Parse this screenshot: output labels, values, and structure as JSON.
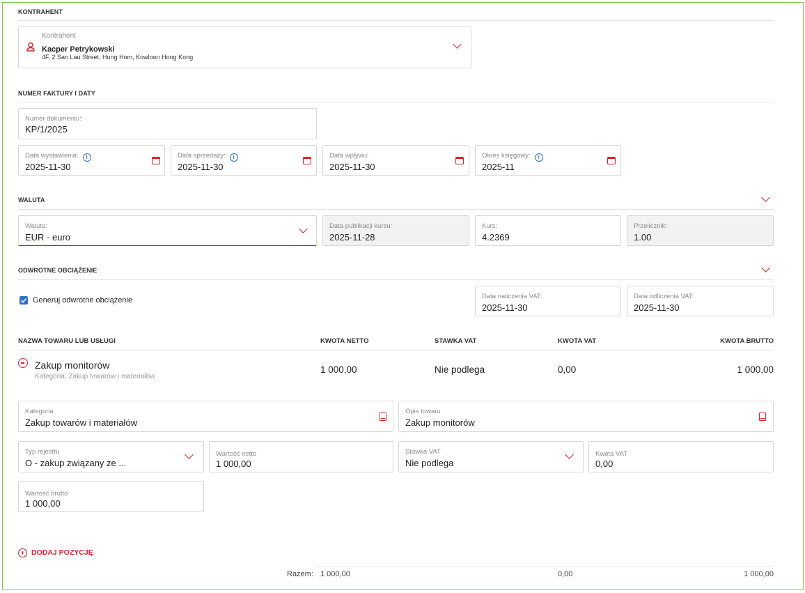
{
  "sections": {
    "kontrahent": "KONTRAHENT",
    "numer": "NUMER FAKTURY I DATY",
    "waluta": "WALUTA",
    "odwrotne": "ODWROTNE OBCIĄŻENIE"
  },
  "contractor": {
    "label": "Kontrahent",
    "name": "Kacper Petrykowski",
    "address": "4F, 2 San Lau Street, Hung Hom, Kowloon Hong Kong"
  },
  "document": {
    "number_label": "Numer dokumentu:",
    "number_value": "KP/1/2025",
    "issue_label": "Data wystawienia:",
    "issue_value": "2025-11-30",
    "sale_label": "Data sprzedaży:",
    "sale_value": "2025-11-30",
    "receipt_label": "Data wpływu:",
    "receipt_value": "2025-11-30",
    "period_label": "Okres księgowy:",
    "period_value": "2025-11"
  },
  "currency": {
    "currency_label": "Waluta:",
    "currency_value": "EUR - euro",
    "pub_label": "Data publikacji kursu:",
    "pub_value": "2025-11-28",
    "rate_label": "Kurs:",
    "rate_value": "4.2369",
    "conv_label": "Przelicznik:",
    "conv_value": "1.00"
  },
  "reverse": {
    "checkbox_label": "Generuj odwrotne obciążenie",
    "checked": true,
    "vat_charge_label": "Data naliczenia VAT:",
    "vat_charge_value": "2025-11-30",
    "vat_deduct_label": "Data odliczenia VAT:",
    "vat_deduct_value": "2025-11-30"
  },
  "table": {
    "headers": {
      "name": "NAZWA TOWARU LUB USŁUGI",
      "netto": "KWOTA NETTO",
      "rate": "STAWKA VAT",
      "vat": "KWOTA VAT",
      "brutto": "KWOTA BRUTTO"
    },
    "row": {
      "name": "Zakup monitorów",
      "category": "Kategoria: Zakup towarów i materiałów",
      "netto": "1 000,00",
      "rate": "Nie podlega",
      "vat": "0,00",
      "brutto": "1 000,00"
    }
  },
  "item_form": {
    "category_label": "Kategoria",
    "category_value": "Zakup towarów i materiałów",
    "desc_label": "Opis towaru",
    "desc_value": "Zakup monitorów",
    "register_label": "Typ rejestru",
    "register_value": "O - zakup związany ze ...",
    "netto_label": "Wartość netto",
    "netto_value": "1 000,00",
    "rate_label": "Stawka VAT",
    "rate_value": "Nie podlega",
    "vat_label": "Kwota VAT",
    "vat_value": "0,00",
    "brutto_label": "Wartość brutto",
    "brutto_value": "1 000,00"
  },
  "add_position": "DODAJ POZYCJĘ",
  "totals": {
    "label": "Razem:",
    "netto": "1 000,00",
    "vat": "0,00",
    "brutto": "1 000,00"
  },
  "colors": {
    "accent": "#d8232a",
    "info": "#2b72c8",
    "frame": "#8bc34a"
  }
}
